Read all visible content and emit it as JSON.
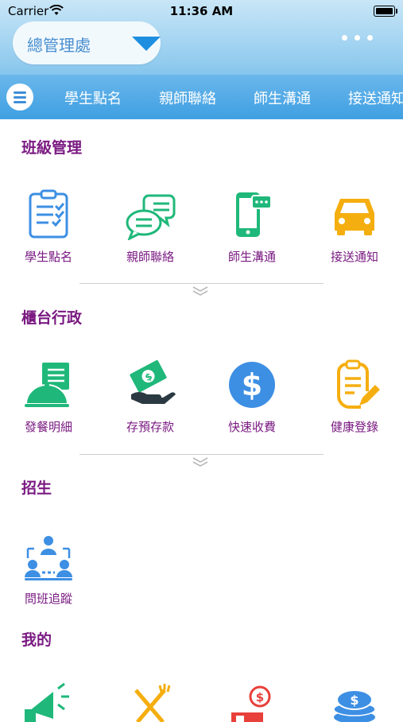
{
  "status": {
    "carrier": "Carrier",
    "time": "11:36 AM"
  },
  "header": {
    "org": "總管理處"
  },
  "tabs": [
    "學生點名",
    "親師聯絡",
    "師生溝通",
    "接送通知"
  ],
  "sections": [
    {
      "title": "班級管理",
      "items": [
        {
          "label": "學生點名",
          "icon": "clipboard-checklist-icon"
        },
        {
          "label": "親師聯絡",
          "icon": "chat-bubbles-icon"
        },
        {
          "label": "師生溝通",
          "icon": "phone-message-icon"
        },
        {
          "label": "接送通知",
          "icon": "car-icon"
        }
      ]
    },
    {
      "title": "櫃台行政",
      "items": [
        {
          "label": "發餐明細",
          "icon": "meal-cloche-icon"
        },
        {
          "label": "存預存款",
          "icon": "cash-hand-icon"
        },
        {
          "label": "快速收費",
          "icon": "dollar-coin-icon"
        },
        {
          "label": "健康登錄",
          "icon": "health-clipboard-icon"
        }
      ]
    },
    {
      "title": "招生",
      "items": [
        {
          "label": "問班追蹤",
          "icon": "team-tracking-icon"
        }
      ]
    },
    {
      "title": "我的",
      "items": [
        {
          "label": "",
          "icon": "megaphone-icon"
        },
        {
          "label": "",
          "icon": "fork-knife-icon"
        },
        {
          "label": "",
          "icon": "money-ticket-icon"
        },
        {
          "label": "",
          "icon": "coin-stack-icon"
        }
      ]
    }
  ],
  "colors": {
    "title": "#7a1a82",
    "accent": "#1e8fe0",
    "green": "#1fb87a",
    "blue": "#3d8fe3",
    "orange": "#f5ae0f"
  }
}
